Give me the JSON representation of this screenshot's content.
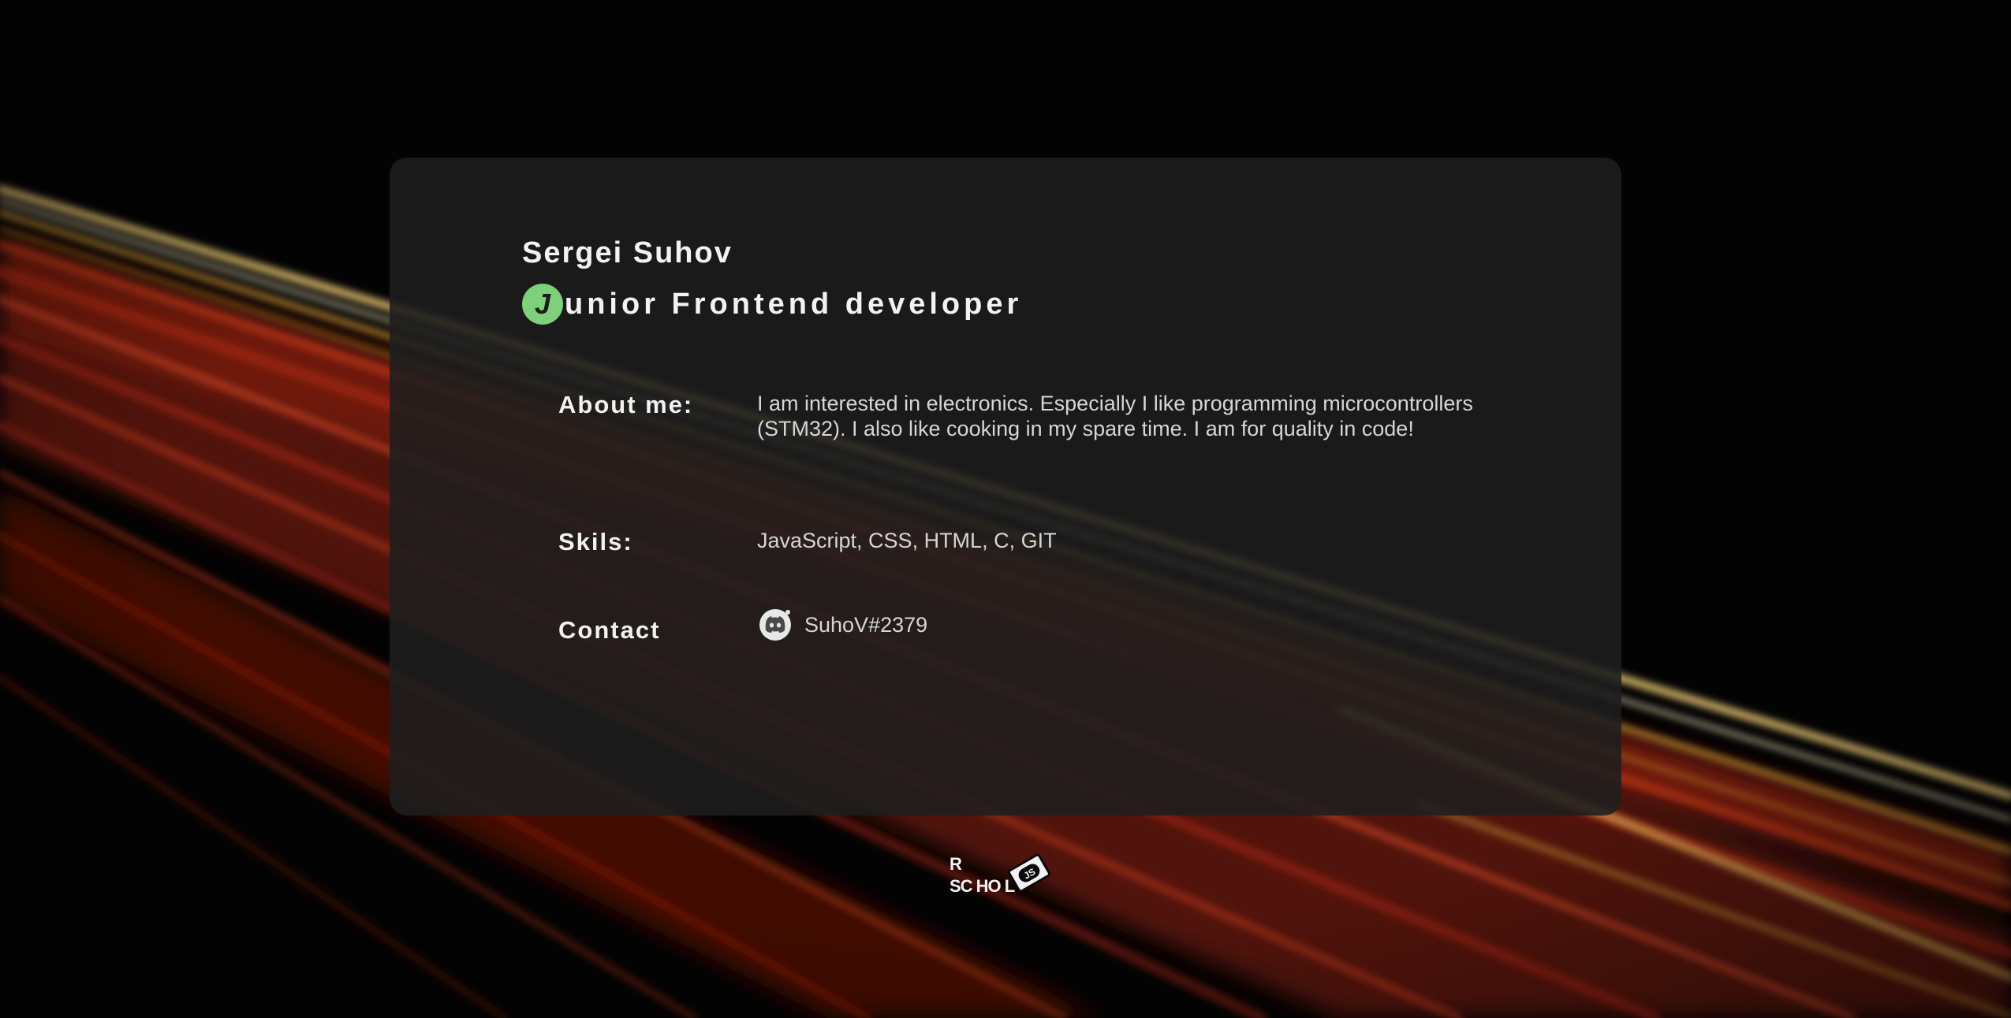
{
  "profile": {
    "name": "Sergei Suhov",
    "role_initial": "J",
    "role_rest": "unior Frontend developer"
  },
  "about": {
    "label": "About me:",
    "text": "I am interested in electronics. Especially I like programming microcontrollers (STM32). I also like cooking in my spare time. I am for quality in code!"
  },
  "skills": {
    "label": "Skils:",
    "text": "JavaScript, CSS, HTML, C, GIT"
  },
  "contact": {
    "label": "Contact",
    "icon": "discord-icon",
    "handle": "SuhoV#2379"
  },
  "footer": {
    "logo_icon": "rs-school-logo",
    "logo_r": "R",
    "logo_school": "SC HO   L",
    "logo_js": "JS"
  },
  "colors": {
    "background": "#020202",
    "card": "#1e1e1e",
    "accent_badge": "#7ed07a",
    "text_primary": "#f2f2f2",
    "text_secondary": "#d6d6d6"
  }
}
